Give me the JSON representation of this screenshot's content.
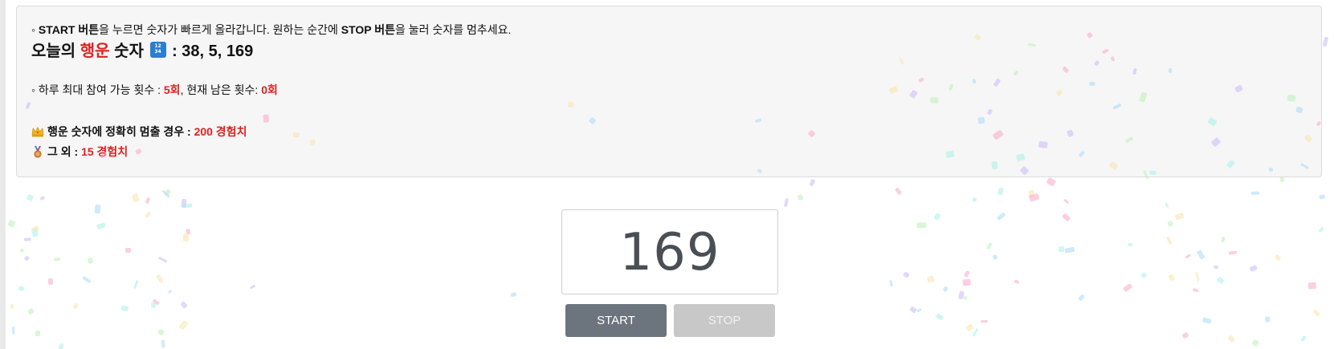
{
  "info": {
    "instruction": {
      "prefix": "◦ ",
      "start_word": "START 버튼",
      "mid": "을 누르면 숫자가 빠르게 올라갑니다. 원하는 순간에 ",
      "stop_word": "STOP 버튼",
      "suffix": "을 눌러 숫자를 멈추세요."
    },
    "lucky": {
      "label_before": "오늘의 ",
      "label_red": "행운",
      "label_after": " 숫자",
      "badge_icon": "numbers-icon",
      "numbers": ": 38, 5, 169"
    },
    "attempts": {
      "max_label": "◦ 하루 최대 참여 가능 횟수 : ",
      "max_value": "5회",
      "remaining_label": ", 현재 남은 횟수: ",
      "remaining_value": "0회"
    },
    "rewards": [
      {
        "icon": "crown-icon",
        "label": "행운 숫자에 정확히 멈출 경우 : ",
        "value": "200 경험치"
      },
      {
        "icon": "medal-icon",
        "label": "그 외 : ",
        "value": "15 경험치"
      }
    ]
  },
  "counter": {
    "value": "169"
  },
  "buttons": {
    "start": "START",
    "stop": "STOP"
  },
  "colors": {
    "accent_red": "#e02020",
    "start_button": "#6c757d",
    "stop_button_disabled": "#c8c8c8",
    "panel_bg": "#f6f6f6"
  }
}
